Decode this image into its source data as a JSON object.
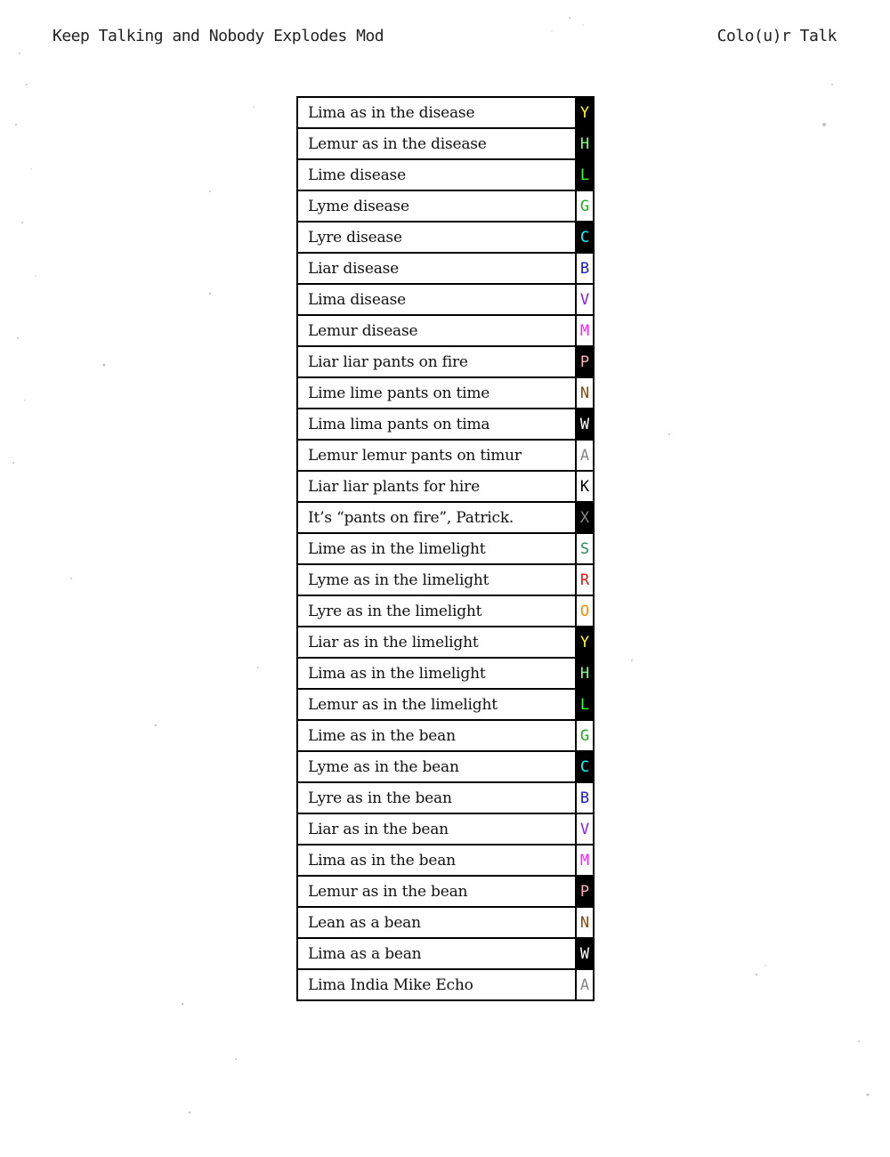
{
  "header": {
    "left": "Keep Talking and Nobody Explodes Mod",
    "right": "Colo(u)r Talk"
  },
  "rows": [
    {
      "phrase": "Lima as in the disease",
      "letter": "Y",
      "color": "#ffff00",
      "bg": "#000000"
    },
    {
      "phrase": "Lemur as in the disease",
      "letter": "H",
      "color": "#7dff7d",
      "bg": "#000000"
    },
    {
      "phrase": "Lime disease",
      "letter": "L",
      "color": "#33ff33",
      "bg": "#000000"
    },
    {
      "phrase": "Lyme disease",
      "letter": "G",
      "color": "#22aa22",
      "bg": "#ffffff"
    },
    {
      "phrase": "Lyre disease",
      "letter": "C",
      "color": "#00ffff",
      "bg": "#000000"
    },
    {
      "phrase": "Liar disease",
      "letter": "B",
      "color": "#1a1acc",
      "bg": "#ffffff"
    },
    {
      "phrase": "Lima disease",
      "letter": "V",
      "color": "#8a1ee6",
      "bg": "#ffffff"
    },
    {
      "phrase": "Lemur disease",
      "letter": "M",
      "color": "#ff22ff",
      "bg": "#ffffff"
    },
    {
      "phrase": "Liar liar pants on fire",
      "letter": "P",
      "color": "#ffb0c0",
      "bg": "#000000"
    },
    {
      "phrase": "Lime lime pants on time",
      "letter": "N",
      "color": "#8b4a13",
      "bg": "#ffffff"
    },
    {
      "phrase": "Lima lima pants on tima",
      "letter": "W",
      "color": "#ffffff",
      "bg": "#000000"
    },
    {
      "phrase": "Lemur lemur pants on timur",
      "letter": "A",
      "color": "#888888",
      "bg": "#ffffff"
    },
    {
      "phrase": "Liar liar plants for hire",
      "letter": "K",
      "color": "#000000",
      "bg": "#ffffff"
    },
    {
      "phrase": "It’s “pants on fire”, Patrick.",
      "letter": "X",
      "color": "#888888",
      "bg": "#000000"
    },
    {
      "phrase": "Lime as in the limelight",
      "letter": "S",
      "color": "#2e8b57",
      "bg": "#ffffff"
    },
    {
      "phrase": "Lyme as in the limelight",
      "letter": "R",
      "color": "#ee1111",
      "bg": "#ffffff"
    },
    {
      "phrase": "Lyre as in the limelight",
      "letter": "O",
      "color": "#ff8c00",
      "bg": "#ffffff"
    },
    {
      "phrase": "Liar as in the limelight",
      "letter": "Y",
      "color": "#ffff00",
      "bg": "#000000"
    },
    {
      "phrase": "Lima as in the limelight",
      "letter": "H",
      "color": "#7dff7d",
      "bg": "#000000"
    },
    {
      "phrase": "Lemur as in the limelight",
      "letter": "L",
      "color": "#33ff33",
      "bg": "#000000"
    },
    {
      "phrase": "Lime as in the bean",
      "letter": "G",
      "color": "#22aa22",
      "bg": "#ffffff"
    },
    {
      "phrase": "Lyme as in the bean",
      "letter": "C",
      "color": "#00ffff",
      "bg": "#000000"
    },
    {
      "phrase": "Lyre as in the bean",
      "letter": "B",
      "color": "#1a1acc",
      "bg": "#ffffff"
    },
    {
      "phrase": "Liar as in the bean",
      "letter": "V",
      "color": "#8a1ee6",
      "bg": "#ffffff"
    },
    {
      "phrase": "Lima as in the bean",
      "letter": "M",
      "color": "#ff22ff",
      "bg": "#ffffff"
    },
    {
      "phrase": "Lemur as in the bean",
      "letter": "P",
      "color": "#ffb0c0",
      "bg": "#000000"
    },
    {
      "phrase": "Lean as a bean",
      "letter": "N",
      "color": "#8b4a13",
      "bg": "#ffffff"
    },
    {
      "phrase": "Lima as a bean",
      "letter": "W",
      "color": "#ffffff",
      "bg": "#000000"
    },
    {
      "phrase": "Lima India Mike Echo",
      "letter": "A",
      "color": "#888888",
      "bg": "#ffffff"
    }
  ]
}
